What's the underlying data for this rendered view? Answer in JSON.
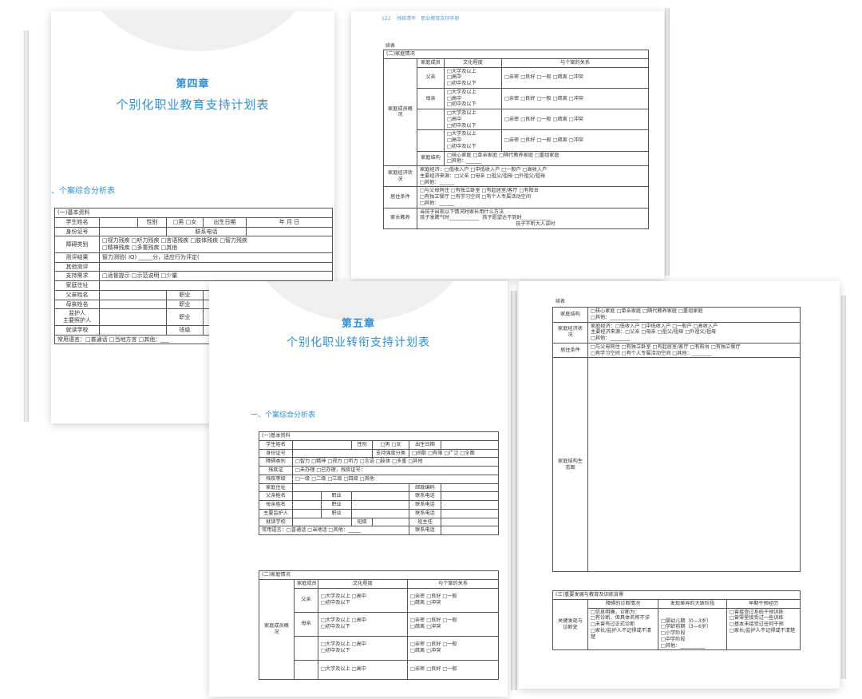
{
  "book1": {
    "header": {
      "page_no": "122",
      "title": "残疾青年",
      "subtitle": "职业教育支持手册"
    },
    "left": {
      "chapter": "第四章",
      "title": "个别化职业教育支持计划表",
      "section": "一、个案综合分析表",
      "basic": {
        "heading": "(一)基本资料",
        "student_name": "学生姓名",
        "gender": "性别",
        "gender_opts": "□男 □女",
        "dob": "出生日期",
        "ymd": "年 月 日",
        "id": "身份证号",
        "phone": "联系电话",
        "dis_type": "障碍类别",
        "dis_opts1": "□视力残疾 □听力残疾 □言语残疾 □肢体残疾 □智力残疾",
        "dis_opts2": "□精神残疾 □多重残疾 □其他",
        "test": "测评结果",
        "test_val": "智力测验( IQ) _____分，适应行为评定(",
        "other_test": "其他测评",
        "support": "支持需求",
        "support_val": "□适督提示 □示范说明 □少量",
        "address": "家庭住址",
        "father": "父亲姓名",
        "mother": "母亲姓名",
        "guardian": "监护人",
        "guardian2": "主要照护人",
        "job": "职业",
        "school": "就读学校",
        "class": "班级",
        "lang": "常用语言：□普通话 □当地方言 □其他：___"
      }
    },
    "right": {
      "cont": "续表",
      "heading": "(二)家庭情况",
      "col_member": "家庭成员",
      "col_edu": "文化程度",
      "col_rel": "与个案的关系",
      "overview": "家庭成员概况",
      "father": "父亲",
      "mother": "母亲",
      "edu1": "□大学及以上",
      "edu2": "□高中",
      "edu3": "□初中及以下",
      "rel": "□亲密 □良好 □一般 □疏离 □冲突",
      "structure": "家庭结构",
      "structure_opts": "□核心家庭 □单亲家庭 □隔代教养家庭 □重组家庭",
      "other": "□其他：______",
      "econ": "家庭经济状况",
      "econ1": "家庭经济：□低收入户 □中低收入户 □一般户 □高收入户",
      "econ2": "主要经济来源：□父亲 □母亲 □祖父/祖母 □外祖父/祖母",
      "living": "居住条件",
      "living1": "□与父母同住 □有独立卧室 □有起居室/客厅 □有阳台",
      "living2": "□有独立餐厅 □有学习空间 □有个人专属活动空间",
      "edu_method": "家长教养",
      "method_q": "当孩子出现以下情况时家长用什么方法",
      "method1": "孩子发脾气时____________",
      "method2": "孩子愿望达不到时____________",
      "method3": "孩子不听大人讲时"
    }
  },
  "book2": {
    "left": {
      "chapter": "第五章",
      "title": "个别化职业转衔支持计划表",
      "section": "一、个案综合分析表",
      "basic": {
        "heading": "(一)基本资料",
        "student_name": "学生姓名",
        "gender": "性别",
        "gender_opts": "□男 □女",
        "dob": "出生日期",
        "id": "身份证号",
        "support_cat": "支持强度分类",
        "support_opts": "□间歇 □有限 □广泛 □全面",
        "dis_type": "障碍类别",
        "dis_opts": "□智力 □精神 □视力 □听力 □言语 □肢体 □多重 □其他",
        "cert": "残疾证",
        "cert_opts": "□未办理 □已办理，残疾证号：",
        "level": "残疾等级",
        "level_opts": "□一级 □二级 □三级 □四级 □其他",
        "address": "家庭住址",
        "postcode": "邮政编码",
        "father": "父亲姓名",
        "mother": "母亲姓名",
        "guardian": "主要监护人",
        "job": "职业",
        "phone": "联系电话",
        "school": "就读学校",
        "class": "班级",
        "teacher": "班主任",
        "lang": "常用语言：□普通话 □当地话 □其他：_____",
        "lang_phone": "联系电话"
      },
      "family": {
        "heading": "(二)家庭情况",
        "col_member": "家庭成员",
        "col_edu": "文化程度",
        "col_rel": "与个案的关系",
        "overview": "家庭成员概况",
        "father": "父亲",
        "mother": "母亲",
        "edu_a": "□大学及以上 □高中",
        "edu_b": "□初中及以下",
        "rel_a": "□亲密 □良好 □一般",
        "rel_b": "□疏离 □冲突"
      }
    },
    "right": {
      "cont": "续表",
      "structure": "家庭结构",
      "structure_opts": "□核心家庭 □单亲家庭 □隔代教养家庭 □重组家庭",
      "other": "□其他：____________",
      "econ": "家庭经济状况",
      "econ1": "家庭经济：□低收入户 □中低收入户 □一般户 □高收入户",
      "econ2": "主要经济来源：□父亲 □母亲 □祖父/祖母 □外祖父/祖母",
      "other2": "□其他：________",
      "living": "居住条件",
      "living1": "□与父母同住 □有独立卧室 □有起居室/客厅 □有阳台 □有独立餐厅",
      "living2": "□有学习空间 □有个人专属活动空间 □其他：________",
      "eco": "家庭结构生态图",
      "dev_heading": "(三)重要发展与教育及训练背景",
      "col_diag": "障碍的诊断情况",
      "col_stage": "发现差异的大致阶段",
      "col_early": "早期干预经历",
      "key": "关键发现与诊断史",
      "diag1": "□信息明确，诊断为：",
      "diag2": "□有诊断，但具体名称不详",
      "diag3": "□未曾有过正式诊断",
      "diag4": "□家长/监护人不记得或不清楚",
      "stage1": "□婴幼儿期（0—3岁）",
      "stage2": "□学龄前期（3—6岁）",
      "stage3": "□小学阶段",
      "stage4": "□中学阶段",
      "stage5": "□其他：__________",
      "early1": "□曾接受过系统干预训练",
      "early2": "□曾零星接受过一些训练",
      "early3": "□基本未接受过任何干预",
      "early4": "□家长/监护人不记得或不清楚"
    }
  }
}
